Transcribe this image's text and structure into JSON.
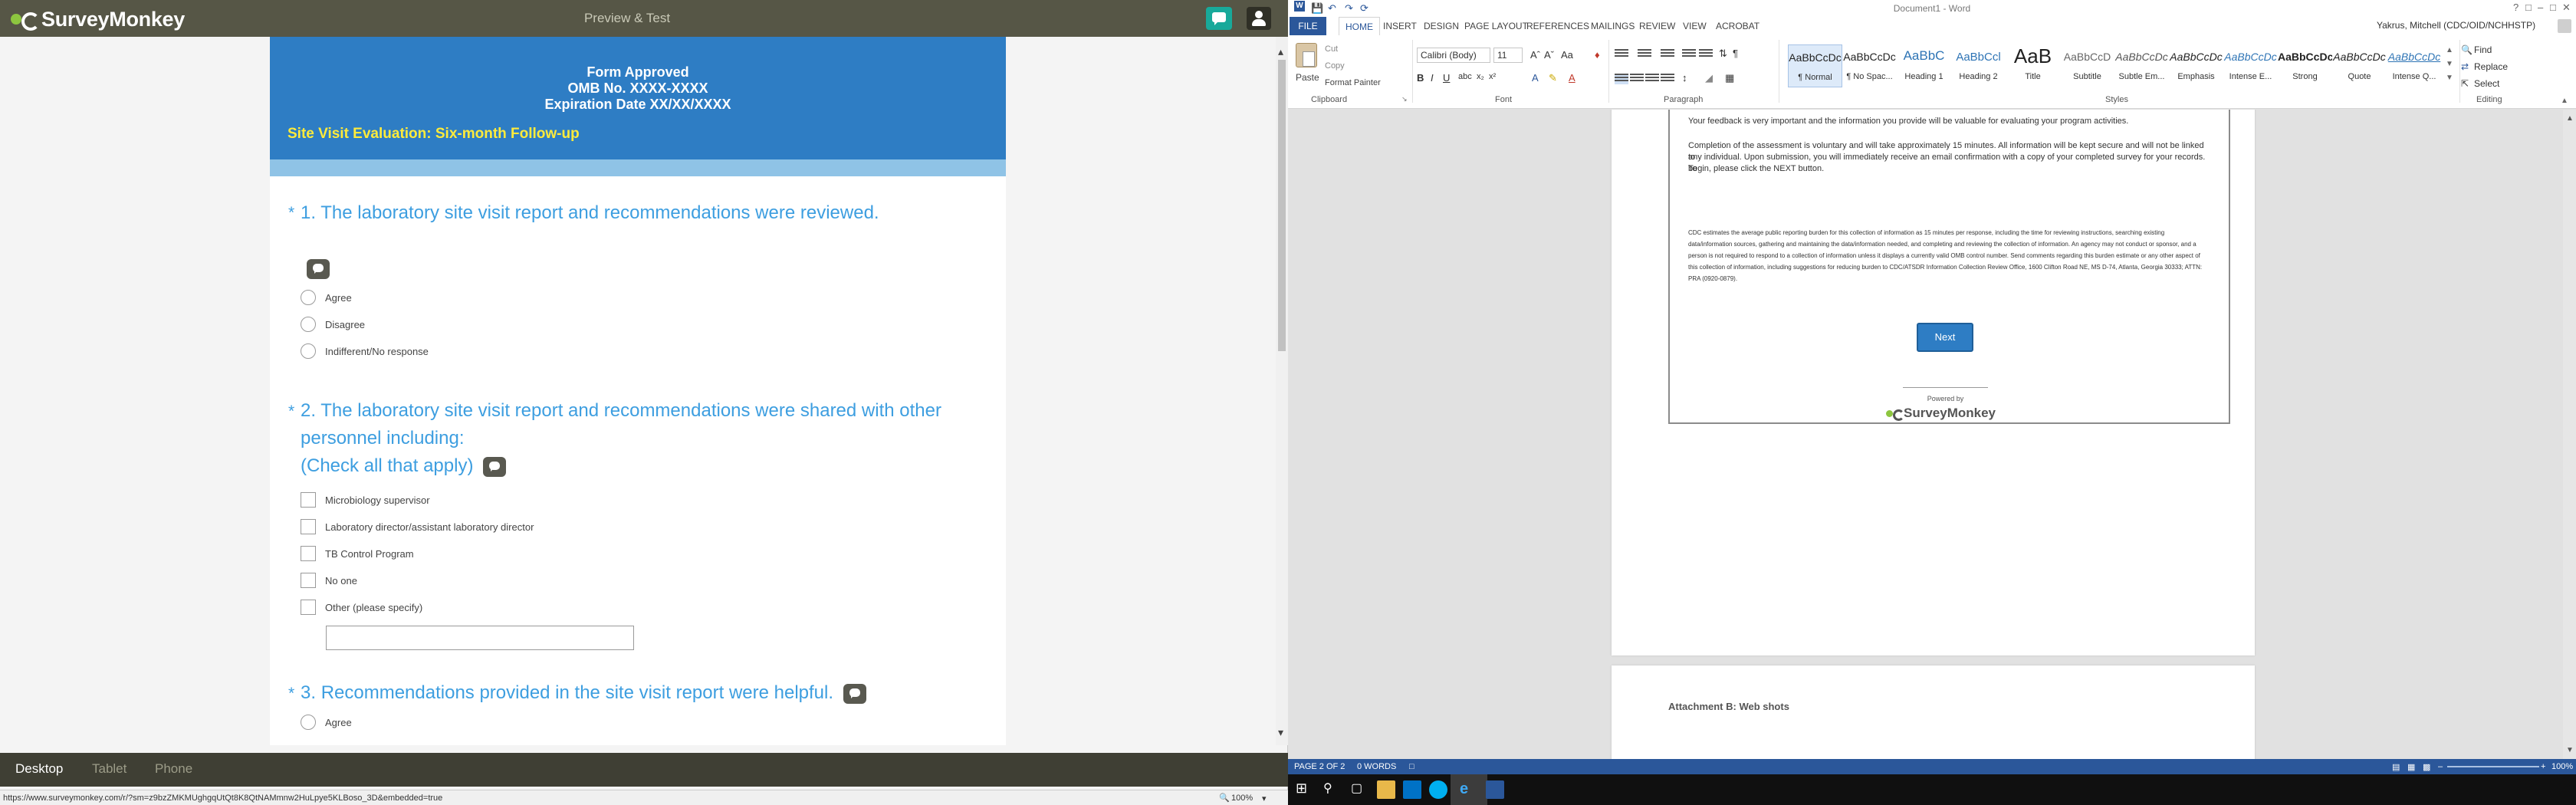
{
  "surveymonkey": {
    "brand": "SurveyMonkey",
    "title": "Preview & Test",
    "header": {
      "line1": "Form Approved",
      "line2": "OMB No. XXXX-XXXX",
      "line3": "Expiration Date XX/XX/XXXX"
    },
    "survey_subtitle": "Site Visit Evaluation: Six-month Follow-up",
    "questions": [
      {
        "number": "1.",
        "text": "The laboratory site visit report and recommendations were reviewed.",
        "options": [
          "Agree",
          "Disagree",
          "Indifferent/No response"
        ]
      },
      {
        "number": "2.",
        "text_line1": "The laboratory site visit report and recommendations were shared with other",
        "text_line2": "personnel including:",
        "text_line3": "(Check all that apply)",
        "options": [
          "Microbiology supervisor",
          "Laboratory director/assistant laboratory director",
          "TB Control Program",
          "No one",
          "Other (please specify)"
        ]
      },
      {
        "number": "3.",
        "text": "Recommendations provided in the site visit report were helpful.",
        "options": [
          "Agree"
        ]
      }
    ],
    "required_marker": "*",
    "device_tabs": [
      "Desktop",
      "Tablet",
      "Phone"
    ],
    "active_device": "Desktop"
  },
  "ie_status": {
    "url": "https://www.surveymonkey.com/r/?sm=z9bzZMKMUghgqUtQt8K8QtNAMmnw2HuLpye5KLBoso_3D&embedded=true",
    "zoom": "100%"
  },
  "word": {
    "doc_title": "Document1 - Word",
    "user": "Yakrus, Mitchell (CDC/OID/NCHHSTP)",
    "tabs": [
      "FILE",
      "HOME",
      "INSERT",
      "DESIGN",
      "PAGE LAYOUT",
      "REFERENCES",
      "MAILINGS",
      "REVIEW",
      "VIEW",
      "ACROBAT"
    ],
    "active_tab": "HOME",
    "clipboard": {
      "paste": "Paste",
      "cut": "Cut",
      "copy": "Copy",
      "format_painter": "Format Painter",
      "label": "Clipboard"
    },
    "font": {
      "name": "Calibri (Body)",
      "size": "11",
      "label": "Font"
    },
    "paragraph_label": "Paragraph",
    "styles_label": "Styles",
    "styles": [
      {
        "preview": "AaBbCcDc",
        "name": "¶ Normal"
      },
      {
        "preview": "AaBbCcDc",
        "name": "¶ No Spac..."
      },
      {
        "preview": "AaBbC",
        "name": "Heading 1"
      },
      {
        "preview": "AaBbCcl",
        "name": "Heading 2"
      },
      {
        "preview": "AaB",
        "name": "Title"
      },
      {
        "preview": "AaBbCcD",
        "name": "Subtitle"
      },
      {
        "preview": "AaBbCcDc",
        "name": "Subtle Em..."
      },
      {
        "preview": "AaBbCcDc",
        "name": "Emphasis"
      },
      {
        "preview": "AaBbCcDc",
        "name": "Intense E..."
      },
      {
        "preview": "AaBbCcDc",
        "name": "Strong"
      },
      {
        "preview": "AaBbCcDc",
        "name": "Quote"
      },
      {
        "preview": "AaBbCcDc",
        "name": "Intense Q..."
      }
    ],
    "editing": {
      "find": "Find",
      "replace": "Replace",
      "select": "Select",
      "label": "Editing"
    },
    "page_content": {
      "feedback": "Your feedback is very important and the information you provide will be valuable for evaluating your program activities.",
      "completion_1": "Completion of the assessment is voluntary and will take approximately 15 minutes. All information will be kept secure and will not be linked to",
      "completion_2": "any individual. Upon submission, you will immediately receive an email confirmation with a copy of your completed survey for your records. To",
      "completion_3": "begin, please click the NEXT button.",
      "burden_1": "CDC estimates the average public reporting burden for this collection of information as 15 minutes per response, including the time for reviewing instructions, searching existing",
      "burden_2": "data/information sources, gathering and maintaining the data/information needed, and completing and reviewing the collection of information. An agency may not conduct or sponsor, and a",
      "burden_3": "person is not required to respond to a collection of information unless it displays a currently valid OMB control number. Send comments regarding this burden estimate or any other aspect of",
      "burden_4": "this collection of information, including suggestions for reducing burden to CDC/ATSDR Information Collection Review Office, 1600 Clifton Road NE, MS D-74, Atlanta, Georgia 30333; ATTN:",
      "burden_5": "PRA (0920-0879).",
      "next_button": "Next",
      "powered_by": "Powered by",
      "powered_brand": "SurveyMonkey",
      "attachment": "Attachment B: Web shots"
    },
    "status": {
      "page": "PAGE 2 OF 2",
      "words": "0 WORDS",
      "zoom": "100%"
    }
  }
}
